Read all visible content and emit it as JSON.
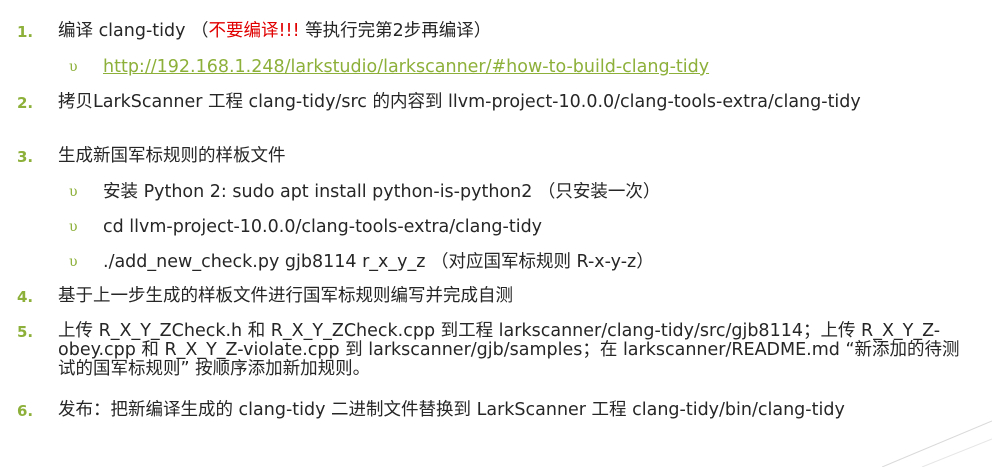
{
  "items": [
    {
      "number": "1.",
      "text_pre": "编译 clang-tidy （",
      "text_red": "不要编译!!!",
      "text_post": " 等执行完第2步再编译）"
    },
    {
      "number": "2.",
      "text": "拷贝LarkScanner 工程 clang-tidy/src 的内容到 llvm-project-10.0.0/clang-tools-extra/clang-tidy"
    },
    {
      "number": "3.",
      "text": "生成新国军标规则的样板文件"
    },
    {
      "number": "4.",
      "text": "基于上一步生成的样板文件进行国军标规则编写并完成自测"
    },
    {
      "number": "5.",
      "text": "上传 R_X_Y_ZCheck.h 和 R_X_Y_ZCheck.cpp 到工程 larkscanner/clang-tidy/src/gjb8114；上传 R_X_Y_Z-obey.cpp 和 R_X_Y_Z-violate.cpp 到 larkscanner/gjb/samples；在 larkscanner/README.md “新添加的待测试的国军标规则” 按顺序添加新加规则。"
    },
    {
      "number": "6.",
      "text": "发布：把新编译生成的 clang-tidy 二进制文件替换到 LarkScanner 工程 clang-tidy/bin/clang-tidy"
    }
  ],
  "subitems": {
    "item1": [
      {
        "bullet": "υ",
        "link": "http://192.168.1.248/larkstudio/larkscanner/#how-to-build-clang-tidy"
      }
    ],
    "item3": [
      {
        "bullet": "υ",
        "text": "安装 Python 2: sudo apt install python-is-python2 （只安装一次）"
      },
      {
        "bullet": "υ",
        "text": "cd llvm-project-10.0.0/clang-tools-extra/clang-tidy"
      },
      {
        "bullet": "υ",
        "text": "./add_new_check.py gjb8114 r_x_y_z （对应国军标规则 R-x-y-z）"
      }
    ]
  },
  "colors": {
    "accent": "#8DB03A",
    "warning": "#E00000",
    "text": "#262626"
  }
}
